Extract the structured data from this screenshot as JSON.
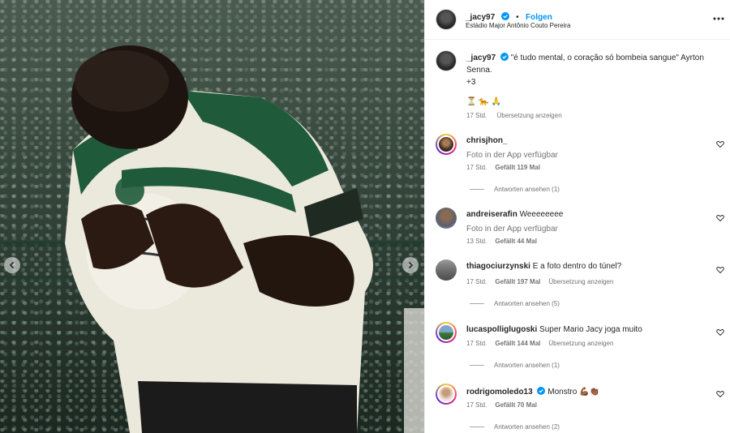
{
  "post": {
    "author": "_jacy97",
    "follow_label": "Folgen",
    "separator": "•",
    "location": "Estádio Major Antônio Couto Pereira",
    "caption": "\"é tudo mental, o coração só bombeia sangue\" Ayrton Senna.",
    "caption_extra": "+3",
    "caption_emojis": "⏳ 🐆 🙏",
    "time": "17 Std.",
    "translate_label": "Übersetzung anzeigen"
  },
  "comments": [
    {
      "user": "chrisjhon_",
      "text": "",
      "sub": "Foto in der App verfügbar",
      "time": "17 Std.",
      "likes": "Gefällt 119 Mal",
      "translate": "",
      "replies": "Antworten ansehen (1)",
      "verified": false
    },
    {
      "user": "andreiserafin",
      "text": "Weeeeeeee",
      "sub": "Foto in der App verfügbar",
      "time": "13 Std.",
      "likes": "Gefällt 44 Mal",
      "translate": "",
      "replies": "",
      "verified": false
    },
    {
      "user": "thiagociurzynski",
      "text": "E a foto dentro do túnel?",
      "sub": "",
      "time": "17 Std.",
      "likes": "Gefällt 197 Mal",
      "translate": "Übersetzung anzeigen",
      "replies": "Antworten ansehen (5)",
      "verified": false
    },
    {
      "user": "lucaspolliglugoski",
      "text": "Super Mario Jacy joga muito",
      "sub": "",
      "time": "17 Std.",
      "likes": "Gefällt 144 Mal",
      "translate": "Übersetzung anzeigen",
      "replies": "Antworten ansehen (1)",
      "verified": false
    },
    {
      "user": "rodrigomoledo13",
      "text": "Monstro 💪🏾👏🏾",
      "sub": "",
      "time": "17 Std.",
      "likes": "Gefällt 70 Mal",
      "translate": "",
      "replies": "Antworten ansehen (2)",
      "verified": true
    }
  ],
  "icons": {
    "prev": "chevron-left-icon",
    "next": "chevron-right-icon",
    "more": "more-options-icon",
    "heart": "heart-icon",
    "verified": "verified-badge-icon"
  },
  "colors": {
    "accent": "#0095f6",
    "muted": "#737373",
    "jersey_green": "#1f5a3a"
  }
}
